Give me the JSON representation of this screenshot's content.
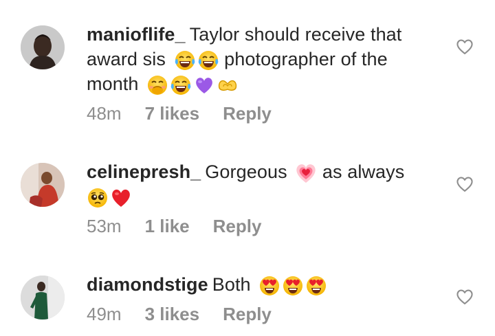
{
  "comments": [
    {
      "username": "manioflife_",
      "text_part1": "Taylor should receive that award sis",
      "emojis_inline": [
        "face-with-tears-of-joy-icon",
        "face-with-tears-of-joy-icon"
      ],
      "text_part2": "photographer of the month",
      "emojis_end": [
        "face-with-hand-over-mouth-icon",
        "face-with-tears-of-joy-icon",
        "purple-heart-icon",
        "heart-hands-icon"
      ],
      "time": "48m",
      "likes": "7 likes",
      "reply": "Reply"
    },
    {
      "username": "celinepresh_",
      "text_part1": "Gorgeous",
      "emojis_inline": [
        "growing-heart-icon"
      ],
      "text_part2": "as always",
      "emojis_end": [
        "pleading-face-icon",
        "red-heart-icon"
      ],
      "time": "53m",
      "likes": "1 like",
      "reply": "Reply"
    },
    {
      "username": "diamondstige",
      "text_part1": "Both",
      "emojis_end": [
        "heart-eyes-face-icon",
        "heart-eyes-face-icon",
        "heart-eyes-face-icon"
      ],
      "time": "49m",
      "likes": "3 likes",
      "reply": "Reply"
    }
  ],
  "colors": {
    "text": "#262626",
    "meta": "#8e8e8e",
    "emoji_yellow": "#ffcc33",
    "purple_heart": "#9b59e6",
    "red_heart": "#e8202b"
  }
}
